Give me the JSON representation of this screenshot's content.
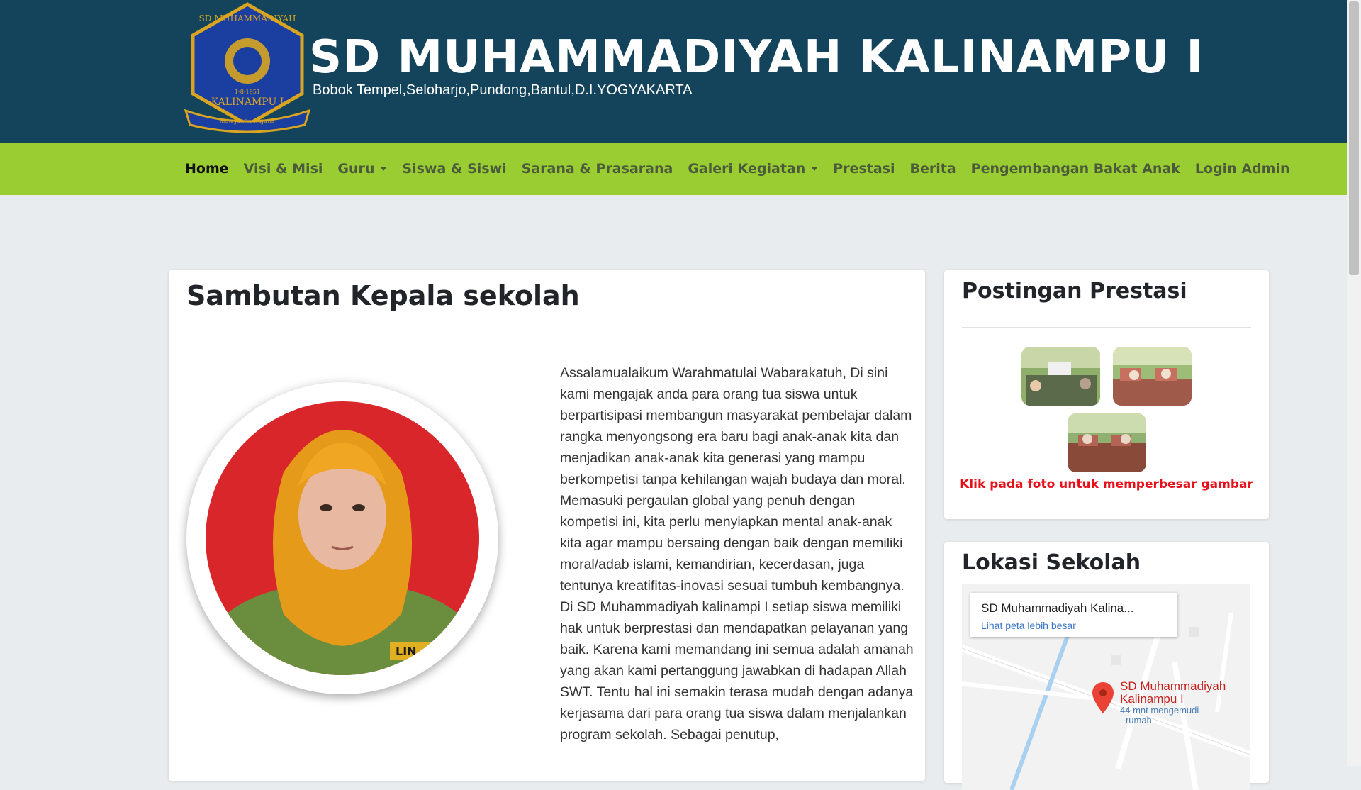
{
  "header": {
    "title": "SD MUHAMMADIYAH KALINAMPU I",
    "address": "Bobok Tempel,Seloharjo,Pundong,Bantul,D.I.YOGYAKARTA",
    "logo_text": {
      "top_arc": "SD MUHAMMADIYAH",
      "date": "1-8-1951",
      "name": "KALINAMPU I",
      "motto": "MAN JADDA WAJADA"
    }
  },
  "nav": {
    "items": [
      {
        "label": "Home",
        "active": true,
        "dropdown": false
      },
      {
        "label": "Visi & Misi",
        "active": false,
        "dropdown": false
      },
      {
        "label": "Guru",
        "active": false,
        "dropdown": true
      },
      {
        "label": "Siswa & Siswi",
        "active": false,
        "dropdown": false
      },
      {
        "label": "Sarana & Prasarana",
        "active": false,
        "dropdown": false
      },
      {
        "label": "Galeri Kegiatan",
        "active": false,
        "dropdown": true
      },
      {
        "label": "Prestasi",
        "active": false,
        "dropdown": false
      },
      {
        "label": "Berita",
        "active": false,
        "dropdown": false
      },
      {
        "label": "Pengembangan Bakat Anak",
        "active": false,
        "dropdown": false
      },
      {
        "label": "Login Admin",
        "active": false,
        "dropdown": false
      }
    ]
  },
  "main": {
    "title": "Sambutan Kepala sekolah",
    "photo_badge": "LIN",
    "welcome_text": "Assalamualaikum Warahmatulai Wabarakatuh, Di sini kami mengajak anda para orang tua siswa untuk berpartisipasi membangun masyarakat pembelajar dalam rangka menyongsong era baru bagi anak-anak kita dan menjadikan anak-anak kita generasi yang mampu berkompetisi tanpa kehilangan wajah budaya dan moral. Memasuki pergaulan global yang penuh dengan kompetisi ini, kita perlu menyiapkan mental anak-anak kita agar mampu bersaing dengan baik dengan memiliki moral/adab islami, kemandirian, kecerdasan, juga tentunya kreatifitas-inovasi sesuai tumbuh kembangnya. Di SD Muhammadiyah kalinampi I setiap siswa memiliki hak untuk berprestasi dan mendapatkan pelayanan yang baik. Karena kami memandang ini semua adalah amanah yang akan kami pertanggung jawabkan di hadapan Allah SWT. Tentu hal ini semakin terasa mudah dengan adanya kerjasama dari para orang tua siswa dalam menjalankan program sekolah. Sebagai penutup,"
  },
  "sidebar": {
    "prestasi": {
      "title": "Postingan Prestasi",
      "note": "Klik pada foto untuk memperbesar gambar"
    },
    "lokasi": {
      "title": "Lokasi Sekolah",
      "map": {
        "info_title": "SD Muhammadiyah Kalina...",
        "info_link": "Lihat peta lebih besar",
        "marker_label_1": "SD Muhammadiyah",
        "marker_label_2": "Kalinampu I",
        "distance_1": "44 mnt mengemudi",
        "distance_2": "- rumah"
      }
    }
  },
  "colors": {
    "header_bg": "#13445c",
    "nav_bg": "#9acd32",
    "page_bg": "#e9ecef",
    "note_red": "#e8101a"
  }
}
